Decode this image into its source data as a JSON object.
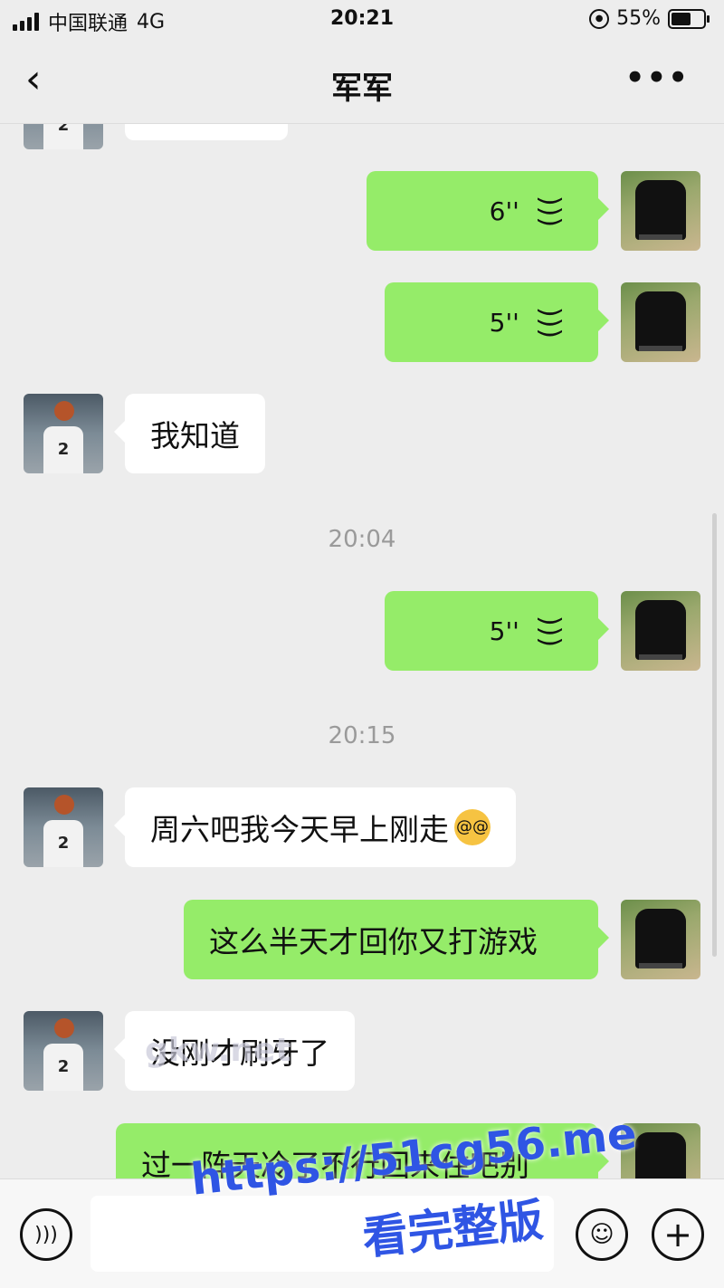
{
  "status_bar": {
    "carrier": "中国联通",
    "network": "4G",
    "time": "20:21",
    "battery": "55%"
  },
  "nav": {
    "back_icon": "chevron-left",
    "title": "军军",
    "more_label": "•••"
  },
  "messages": [
    {
      "side": "right",
      "type": "voice",
      "duration": "6''"
    },
    {
      "side": "right",
      "type": "voice",
      "duration": "5''"
    },
    {
      "side": "left",
      "type": "text",
      "text": "我知道"
    },
    {
      "type": "timestamp",
      "text": "20:04"
    },
    {
      "side": "right",
      "type": "voice",
      "duration": "5''"
    },
    {
      "type": "timestamp",
      "text": "20:15"
    },
    {
      "side": "left",
      "type": "text",
      "text": "周六吧我今天早上刚走",
      "emoji": "dizzy-face"
    },
    {
      "side": "right",
      "type": "text",
      "text": "这么半天才回你又打游戏"
    },
    {
      "side": "left",
      "type": "text",
      "text": "没刚才刷牙了"
    },
    {
      "side": "right",
      "type": "text",
      "text": "过一阵天冷了不行回来住吧别"
    }
  ],
  "avatars": {
    "other_jersey_number": "2"
  },
  "colors": {
    "self_bubble": "#95ec69",
    "other_bubble": "#ffffff",
    "background": "#ededed",
    "watermark": "#2f55e4"
  },
  "watermarks": {
    "faint": "gkw.net",
    "url": "https://51cg56.me",
    "cta": "看完整版"
  }
}
